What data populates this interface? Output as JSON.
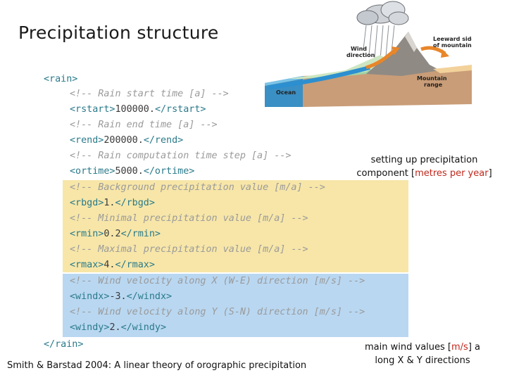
{
  "slide": {
    "title": "Precipitation structure",
    "citation": "Smith & Barstad 2004: A linear theory of orographic precipitation"
  },
  "diagram": {
    "labels": {
      "wind_direction_1": "Wind",
      "wind_direction_2": "direction",
      "leeward_1": "Leeward side",
      "leeward_2": "of mountain",
      "ocean": "Ocean",
      "mountain_1": "Mountain",
      "mountain_2": "range"
    }
  },
  "code": {
    "rain_open": "<rain>",
    "rain_close": "</rain>",
    "lines": [
      {
        "kind": "comment",
        "text": "<!-- Rain start time [a] -->"
      },
      {
        "kind": "elem",
        "open": "<rstart>",
        "value": "100000.",
        "close": "</rstart>"
      },
      {
        "kind": "comment",
        "text": "<!-- Rain end time [a] -->"
      },
      {
        "kind": "elem",
        "open": "<rend>",
        "value": "200000.",
        "close": "</rend>"
      },
      {
        "kind": "comment",
        "text": "<!-- Rain computation time step [a] -->"
      },
      {
        "kind": "elem",
        "open": "<ortime>",
        "value": "5000.",
        "close": "</ortime>"
      },
      {
        "kind": "comment",
        "text": "<!-- Background precipitation value [m/a] -->"
      },
      {
        "kind": "elem",
        "open": "<rbgd>",
        "value": "1.",
        "close": "</rbgd>"
      },
      {
        "kind": "comment",
        "text": "<!-- Minimal precipitation value [m/a] -->"
      },
      {
        "kind": "elem",
        "open": "<rmin>",
        "value": "0.2",
        "close": "</rmin>"
      },
      {
        "kind": "comment",
        "text": "<!-- Maximal precipitation value [m/a] -->"
      },
      {
        "kind": "elem",
        "open": "<rmax>",
        "value": "4.",
        "close": "</rmax>"
      },
      {
        "kind": "comment",
        "text": "<!-- Wind velocity along X (W-E) direction [m/s] -->"
      },
      {
        "kind": "elem",
        "open": "<windx>",
        "value": "-3.",
        "close": "</windx>"
      },
      {
        "kind": "comment",
        "text": "<!-- Wind velocity along Y (S-N) direction [m/s] -->"
      },
      {
        "kind": "elem",
        "open": "<windy>",
        "value": "2.",
        "close": "</windy>"
      }
    ]
  },
  "notes": {
    "precip_line1": "setting up precipitation",
    "precip_line2_pre": "component [",
    "precip_line2_unit": "metres per year",
    "precip_line2_post": "]",
    "wind_line1_pre": "main wind values [",
    "wind_line1_unit": "m/s",
    "wind_line1_post": "] a",
    "wind_line2": "long X & Y directions"
  },
  "colors": {
    "tag": "#2a7a8a",
    "comment": "#9a9a9a",
    "highlight_yellow": "#f7e6a8",
    "highlight_blue": "#b9d7f1",
    "unit_red": "#c0281c"
  }
}
